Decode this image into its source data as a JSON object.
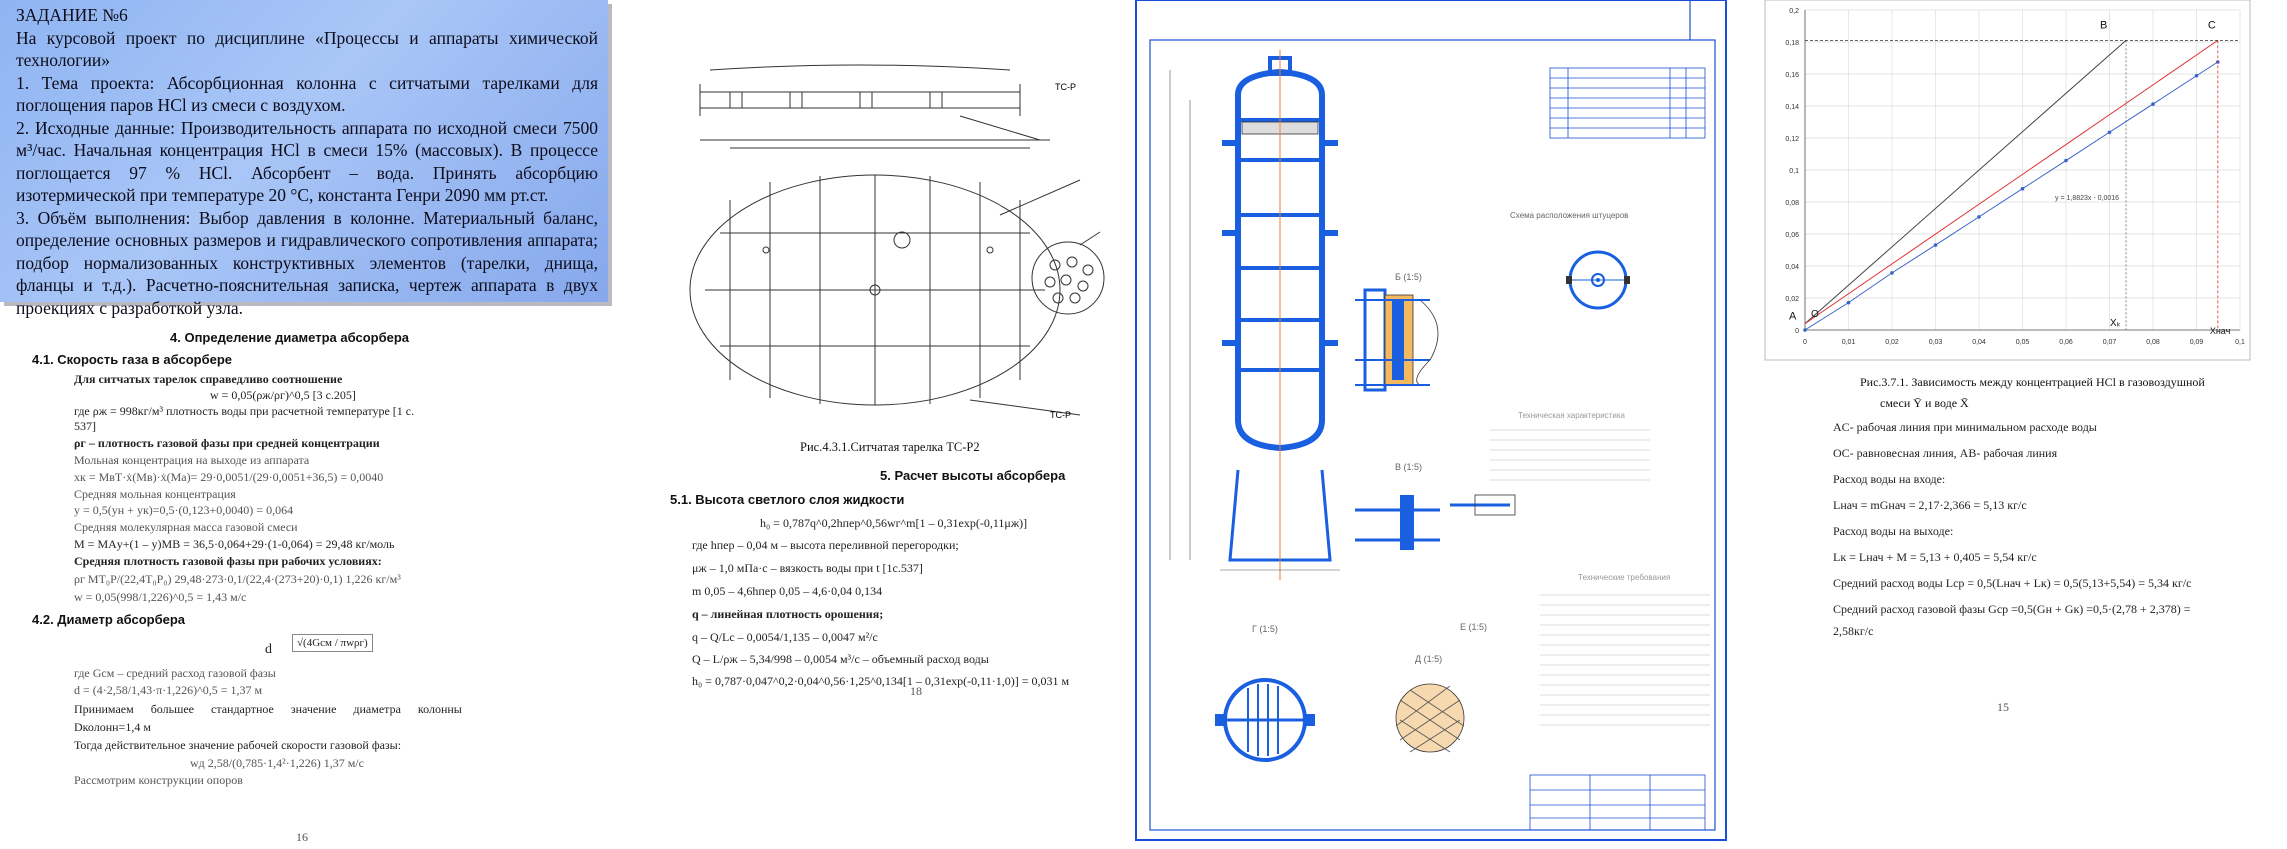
{
  "assignment": {
    "header": "ЗАДАНИЕ №6",
    "intro": "На курсовой проект по дисциплине «Процессы и аппараты химической технологии»",
    "p1": "1. Тема проекта: Абсорбционная колонна с ситчатыми тарелками для поглощения паров HCl из смеси с воздухом.",
    "p2": "2. Исходные данные: Производительность аппарата по исходной смеси 7500 м³/час. Начальная концентрация HCl в смеси 15% (массовых). В процессе поглощается 97 % HCl. Абсорбент – вода. Принять абсорбцию изотермической при температуре 20 °С, константа Генри 2090 мм рт.ст.",
    "p3": "3. Объём выполнения: Выбор давления в колонне. Материальный баланс, определение основных размеров и гидравлического сопротивления аппарата; подбор нормализованных конструктивных элементов (тарелки, днища, фланцы и т.д.). Расчетно-пояснительная записка, чертеж аппарата в двух проекциях с разработкой узла."
  },
  "section4": {
    "title": "4. Определение диаметра абсорбера",
    "s41": "4.1. Скорость газа в абсорбере",
    "lines": [
      "Для ситчатых тарелок справедливо соотношение",
      "w = 0,05(ρж/ρг)^0,5 [3 с.205]",
      "где ρж = 998кг/м³ плотность воды при расчетной температуре [1 с.",
      "537]",
      "ρг – плотность газовой фазы при средней концентрации",
      "Мольная концентрация на выходе из аппарата",
      "xк = МвТ·ẋ(Мв)·ẋ(Ма)= 29·0,0051/(29·0,0051+36,5) = 0,0040",
      "Средняя мольная концентрация",
      "y = 0,5(yн + yк)=0,5·(0,123+0,0040) = 0,064",
      "Средняя молекулярная масса газовой смеси",
      "M = MАy+(1 – y)MВ = 36,5·0,064+29·(1-0,064) = 29,48 кг/моль",
      "Средняя плотность газовой фазы при рабочих условиях:",
      "ρг   MT₀P/(22,4T₀P₀)    29,48·273·0,1/(22,4·(273+20)·0,1)    1,226 кг/м³",
      "w = 0,05(998/1,226)^0,5 = 1,43 м/с"
    ],
    "s42": "4.2. Диаметр абсорбера",
    "d_label": "d",
    "d_formula": "√(4Gсм / πwρг)",
    "lines2": [
      "где Gсм – средний расход газовой фазы",
      "d = (4·2,58/1,43·π·1,226)^0,5 = 1,37 м",
      "Принимаем большее стандартное значение диаметра колонны",
      "Dколонн=1,4 м",
      "Тогда действительное значение рабочей скорости газовой фазы:",
      "wд   2,58/(0,785·1,4²·1,226)    1,37 м/с",
      "Рассмотрим конструкции опоров"
    ],
    "page_no": "16"
  },
  "plate": {
    "caption": "Рис.4.3.1.Ситчатая тарелка ТС-Р2",
    "labels": [
      "ТС-Р",
      "ТС-Р"
    ],
    "s5": "5. Расчет высоты абсорбера",
    "s51": "5.1. Высота светлого слоя жидкости",
    "lines": [
      "h₀ = 0,787q^0,2hпер^0,56wг^m[1 – 0,31exp(-0,11μж)]",
      "где hпер – 0,04 м – высота переливной перегородки;",
      "μж – 1,0 мПа·с – вязкость воды при t [1с.537]",
      "m   0,05 – 4,6hпер   0,05 – 4,6·0,04   0,134",
      "q – линейная плотность орошения;",
      "q – Q/Lc – 0,0054/1,135 – 0,0047 м²/с",
      "Q – L/ρж – 5,34/998 – 0,0054 м³/с – объемный расход воды",
      "h₀ = 0,787·0,047^0,2·0,04^0,56·1,25^0,134[1 – 0,31exp(-0,11·1,0)] = 0,031 м"
    ],
    "page_no": "18"
  },
  "drawing": {
    "sections": [
      "Б (1:5)",
      "В (1:5)",
      "Г (1:5)",
      "Д (1:5)",
      "Е (1:5)"
    ],
    "spec_title": "Техническая характеристика",
    "req_title": "Технические требования",
    "scheme_title": "Схема расположения штуцеров"
  },
  "graph": {
    "chart_data": {
      "type": "line",
      "xlim": [
        0,
        0.1
      ],
      "ylim": [
        0,
        0.2
      ],
      "x_ticks": [
        "0",
        "0,01",
        "0,02",
        "0,03",
        "0,04",
        "0,05",
        "0,06",
        "0,07",
        "0,08",
        "0,09",
        "0,1"
      ],
      "y_ticks": [
        "0",
        "0,02",
        "0,04",
        "0,06",
        "0,08",
        "0,1",
        "0,12",
        "0,14",
        "0,16",
        "0,18",
        "0,2"
      ],
      "grid": true,
      "series": [
        {
          "name": "AB",
          "x": [
            0,
            0.0738
          ],
          "y": [
            0.004,
            0.181
          ]
        },
        {
          "name": "AC",
          "x": [
            0,
            0.0949
          ],
          "y": [
            0.004,
            0.181
          ]
        },
        {
          "name": "OC",
          "x": [
            0,
            0.01,
            0.02,
            0.03,
            0.04,
            0.05,
            0.06,
            0.07,
            0.08,
            0.09,
            0.0949
          ],
          "y": [
            0,
            0.0171,
            0.0357,
            0.0531,
            0.0707,
            0.0883,
            0.1059,
            0.1236,
            0.1412,
            0.1589,
            0.1675
          ]
        }
      ],
      "trendline": "y = 1,8823x - 0,0016",
      "point_labels": [
        "A",
        "B",
        "C",
        "O"
      ],
      "x_marks": [
        "Xₖ",
        "Xнач"
      ]
    },
    "caption_l1": "Рис.3.7.1. Зависимость между концентрацией HCl в газовоздушной",
    "caption_l2": "смеси Ȳ и воде X̄",
    "lines": [
      "AC- рабочая линия при минимальном расходе воды",
      "OC- равновесная линия, AB- рабочая линия",
      "Расход воды на входе:",
      "Lнач = mGнач = 2,17·2,366 = 5,13 кг/с",
      "Расход воды на выходе:",
      "Lк = Lнач + M = 5,13 + 0,405 = 5,54 кг/с",
      "Средний расход воды Lср = 0,5(Lнач + Lк) = 0,5(5,13+5,54) = 5,34 кг/с",
      "Средний расход газовой фазы Gср =0,5(Gн + Gк) =0,5·(2,78 + 2,378) =",
      "2,58кг/с"
    ],
    "page_no": "15"
  }
}
